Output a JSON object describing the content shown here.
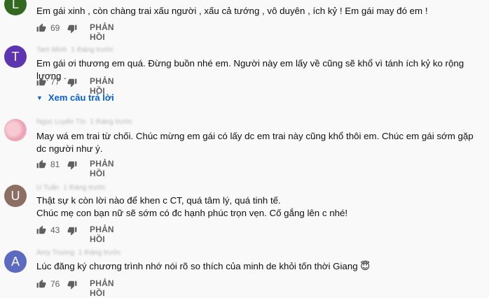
{
  "comments": [
    {
      "avatar_letter": "L",
      "avatar_color": "#33691e",
      "author": "",
      "time": "",
      "text": "Em gái xinh , còn chàng trai xấu người , xấu cả tướng , vô duyên , ích kỷ  ! Em gái may đó em !",
      "likes": "69",
      "reply_label": "PHẢN HỒI"
    },
    {
      "avatar_letter": "T",
      "avatar_color": "#5e35b1",
      "author": "Tam Minh",
      "time": "1 tháng trước",
      "text": "Em gái ơi thương em quá. Đừng buồn nhé em. Người này em lấy về cũng sẽ khổ vì tánh ích kỷ ko rộng lượng .",
      "likes": "77",
      "reply_label": "PHẢN HỒI",
      "view_replies": "Xem câu trả lời"
    },
    {
      "avatar_letter": "",
      "avatar_color": "#f3c6d0",
      "author": "Ngọc Luyến Tìn",
      "time": "1 tháng trước",
      "text": "May wá em trai từ chối. Chúc mừng em gái có lấy dc em trai này cũng khổ thôi em. Chúc em gái sớm gặp dc người như ý.",
      "likes": "81",
      "reply_label": "PHẢN HỒI"
    },
    {
      "avatar_letter": "U",
      "avatar_color": "#8d6e63",
      "author": "U Tuấn",
      "time": "1 tháng trước",
      "text": "Thật sự k còn lời nào để khen c CT, quá tâm lý, quá tinh tế.",
      "text2": "Chúc mẹ con bạn nữ sẽ sớm có đc hạnh phúc trọn vẹn. Cố gắng lên c nhé!",
      "likes": "43",
      "reply_label": "PHẢN HỒI"
    },
    {
      "avatar_letter": "A",
      "avatar_color": "#5c6bc0",
      "author": "Amy Truong",
      "time": "1 tháng trước",
      "text": "Lúc đăng ký chương trình nhớ nói rõ so thích của minh de khỏi tốn thời Giang 😇",
      "likes": "76",
      "reply_label": "PHẢN HỒI"
    }
  ]
}
